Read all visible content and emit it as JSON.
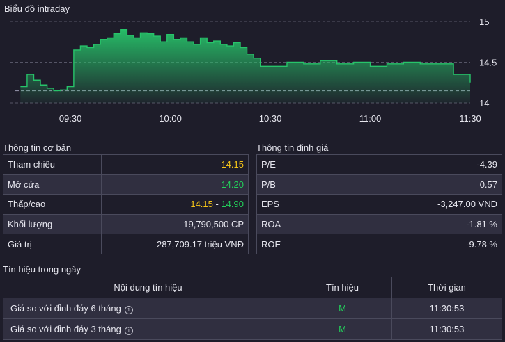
{
  "chart_title": "Biểu đồ intraday",
  "chart_data": {
    "type": "area",
    "x_ticks": [
      "09:30",
      "10:00",
      "10:30",
      "11:00",
      "11:30"
    ],
    "y_ticks": [
      "15",
      "14.5",
      "14"
    ],
    "ylim": [
      14,
      15
    ],
    "reference": 14.15,
    "x": [
      "09:15",
      "09:17",
      "09:19",
      "09:21",
      "09:23",
      "09:25",
      "09:27",
      "09:29",
      "09:31",
      "09:33",
      "09:35",
      "09:37",
      "09:39",
      "09:41",
      "09:43",
      "09:45",
      "09:47",
      "09:49",
      "09:51",
      "09:53",
      "09:55",
      "09:57",
      "09:59",
      "10:01",
      "10:03",
      "10:05",
      "10:07",
      "10:09",
      "10:11",
      "10:13",
      "10:15",
      "10:17",
      "10:19",
      "10:21",
      "10:23",
      "10:25",
      "10:27",
      "10:30",
      "10:35",
      "10:40",
      "10:45",
      "10:50",
      "10:55",
      "11:00",
      "11:05",
      "11:10",
      "11:15",
      "11:20",
      "11:25",
      "11:28",
      "11:30"
    ],
    "values": [
      14.2,
      14.35,
      14.28,
      14.22,
      14.18,
      14.15,
      14.16,
      14.2,
      14.65,
      14.7,
      14.68,
      14.72,
      14.78,
      14.8,
      14.85,
      14.9,
      14.83,
      14.8,
      14.86,
      14.85,
      14.82,
      14.75,
      14.84,
      14.78,
      14.8,
      14.75,
      14.72,
      14.8,
      14.74,
      14.76,
      14.72,
      14.7,
      14.74,
      14.68,
      14.6,
      14.55,
      14.45,
      14.45,
      14.5,
      14.48,
      14.52,
      14.48,
      14.5,
      14.45,
      14.48,
      14.5,
      14.48,
      14.48,
      14.35,
      14.35,
      14.25
    ],
    "line_color": "#27c46a",
    "ref_color": "#8a8aa0"
  },
  "basic": {
    "title": "Thông tin cơ bản",
    "rows": [
      {
        "label": "Tham chiếu",
        "value": "14.15",
        "color": "yellow"
      },
      {
        "label": "Mở cửa",
        "value": "14.20",
        "color": "green"
      },
      {
        "label": "Thấp/cao",
        "low": "14.15",
        "sep": " - ",
        "high": "14.90"
      },
      {
        "label": "Khối lượng",
        "value": "19,790,500 CP",
        "color": "white"
      },
      {
        "label": "Giá trị",
        "value": "287,709.17 triệu VNĐ",
        "color": "white"
      }
    ]
  },
  "valuation": {
    "title": "Thông tin định giá",
    "rows": [
      {
        "label": "P/E",
        "value": "-4.39"
      },
      {
        "label": "P/B",
        "value": "0.57"
      },
      {
        "label": "EPS",
        "value": "-3,247.00 VNĐ"
      },
      {
        "label": "ROA",
        "value": "-1.81 %"
      },
      {
        "label": "ROE",
        "value": "-9.78 %"
      }
    ]
  },
  "signals": {
    "title": "Tín hiệu trong ngày",
    "headers": [
      "Nội dung tín hiệu",
      "Tín hiệu",
      "Thời gian"
    ],
    "rows": [
      {
        "content": "Giá so với đỉnh đáy 6 tháng",
        "signal": "M",
        "time": "11:30:53"
      },
      {
        "content": "Giá so với đỉnh đáy 3 tháng",
        "signal": "M",
        "time": "11:30:53"
      }
    ]
  },
  "icons": {
    "info": "info-icon"
  },
  "colors": {
    "background": "#1e1d2a",
    "row_alt": "#302f40",
    "yellow": "#f5c518",
    "green": "#22d05a"
  }
}
